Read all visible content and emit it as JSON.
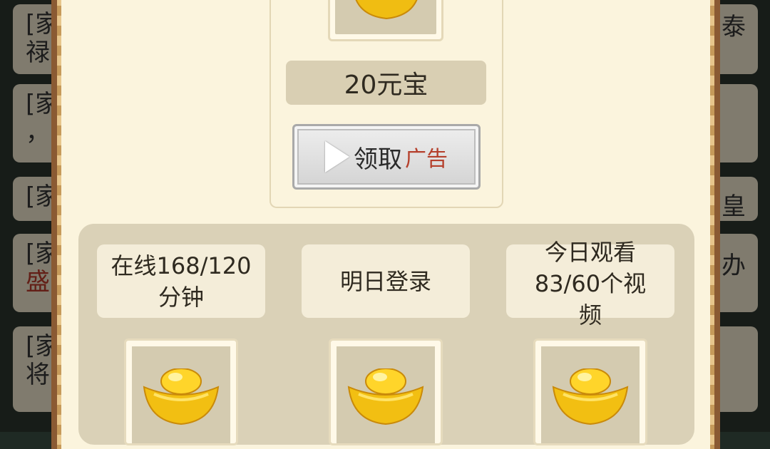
{
  "background_chat": {
    "messages": [
      {
        "line1": "[家",
        "line2": "禄"
      },
      {
        "line1": "[家",
        "line2": "，"
      },
      {
        "line1": "[家",
        "line2": ""
      },
      {
        "line1": "[家",
        "line2_red": "盛"
      },
      {
        "line1": "[家",
        "line2": "将"
      }
    ],
    "right_fragments": [
      "泰",
      "皇",
      "办"
    ]
  },
  "top_reward": {
    "icon": "gold-ingot-icon",
    "amount": "20元宝",
    "claim_label": "领取",
    "ad_label": "广告",
    "play_icon": "play-icon"
  },
  "tasks": [
    {
      "line1": "在线168/120",
      "line2": "分钟",
      "line3": "",
      "icon": "gold-ingot-icon"
    },
    {
      "line1": "明日登录",
      "line2": "",
      "line3": "",
      "icon": "gold-ingot-icon"
    },
    {
      "line1": "今日观看",
      "line2": "83/60个视",
      "line3": "频",
      "icon": "gold-ingot-icon"
    }
  ],
  "colors": {
    "parchment": "#fbf4dd",
    "panel_border": "#8a5a33",
    "ad_red": "#b5402c",
    "gold": "#f2c21b"
  }
}
